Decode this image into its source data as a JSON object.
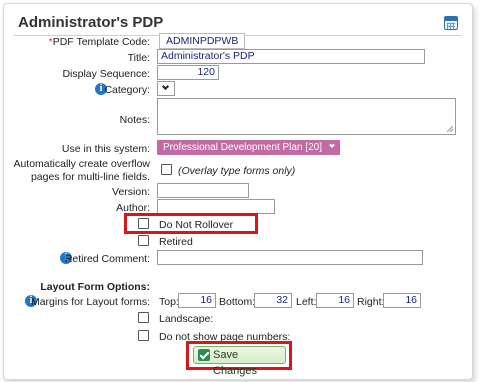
{
  "header": {
    "title": "Administrator's PDP",
    "icon": "calendar-grid-icon"
  },
  "form": {
    "pdf_template_code": {
      "label": "*PDF Template Code:",
      "value": "ADMINPDPWB"
    },
    "title": {
      "label": "*Title:",
      "value": "Administrator's PDP"
    },
    "display_sequence": {
      "label": "*Display Sequence:",
      "value": "120"
    },
    "category": {
      "label": "Category:",
      "value": ""
    },
    "notes": {
      "label": "Notes:",
      "value": ""
    },
    "use_in_system": {
      "label": "*Use in this system:",
      "value": "Professional Development Plan [20]"
    },
    "overflow": {
      "label_line1": "Automatically create overflow",
      "label_line2": "pages for multi-line fields.",
      "note": "(Overlay type forms only)",
      "checked": false
    },
    "version": {
      "label": "Version:",
      "value": ""
    },
    "author": {
      "label": "Author:",
      "value": ""
    },
    "do_not_rollover": {
      "label": "Do Not Rollover",
      "checked": false
    },
    "retired": {
      "label": "Retired",
      "checked": false
    },
    "retired_comment": {
      "label": "Retired Comment:",
      "value": ""
    },
    "layout_options": {
      "heading": "Layout Form Options:"
    },
    "margins": {
      "label": "Margins for Layout forms:",
      "top_label": "Top:",
      "top_value": "16",
      "bottom_label": "Bottom:",
      "bottom_value": "32",
      "left_label": "Left:",
      "left_value": "16",
      "right_label": "Right:",
      "right_value": "16"
    },
    "landscape": {
      "label": "Landscape:",
      "checked": false
    },
    "hide_page_numbers": {
      "label": "Do not show page numbers:",
      "checked": false
    }
  },
  "actions": {
    "save_label": "Save Changes"
  },
  "colors": {
    "required": "#c0392b",
    "system_select": "#c36aa4",
    "highlight": "#d9141d",
    "info_icon": "#1f77c9",
    "save_button": "#d6edc6"
  }
}
